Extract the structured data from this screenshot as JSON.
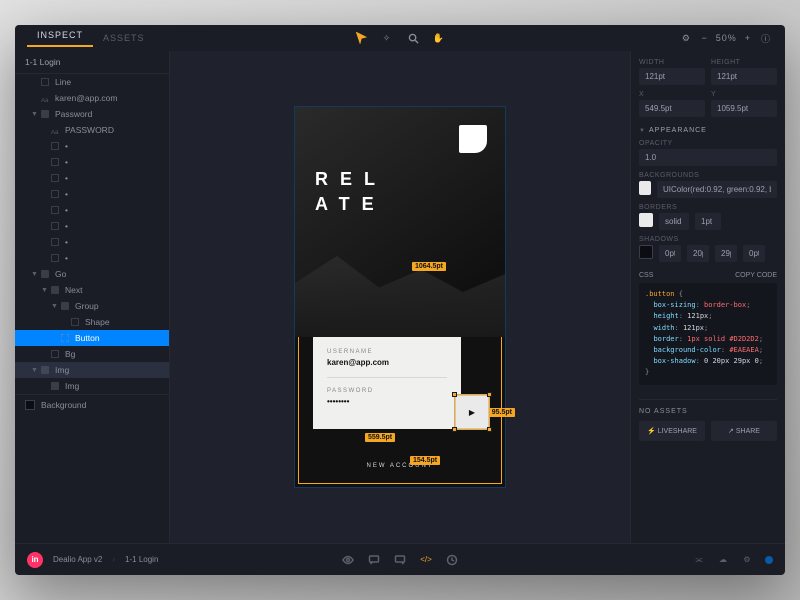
{
  "tabs": {
    "inspect": "INSPECT",
    "assets": "ASSETS"
  },
  "zoom": "50%",
  "artboard_title": "1-1 Login",
  "layers": [
    {
      "name": "Line",
      "indent": 1,
      "icon": "shape"
    },
    {
      "name": "karen@app.com",
      "indent": 1,
      "icon": "text"
    },
    {
      "name": "Password",
      "indent": 1,
      "icon": "folder",
      "chev": "▼"
    },
    {
      "name": "PASSWORD",
      "indent": 2,
      "icon": "text"
    },
    {
      "name": "•",
      "indent": 2,
      "icon": "shape"
    },
    {
      "name": "•",
      "indent": 2,
      "icon": "shape"
    },
    {
      "name": "•",
      "indent": 2,
      "icon": "shape"
    },
    {
      "name": "•",
      "indent": 2,
      "icon": "shape"
    },
    {
      "name": "•",
      "indent": 2,
      "icon": "shape"
    },
    {
      "name": "•",
      "indent": 2,
      "icon": "shape"
    },
    {
      "name": "•",
      "indent": 2,
      "icon": "shape"
    },
    {
      "name": "•",
      "indent": 2,
      "icon": "shape"
    },
    {
      "name": "Go",
      "indent": 1,
      "icon": "folder",
      "chev": "▼"
    },
    {
      "name": "Next",
      "indent": 2,
      "icon": "folder",
      "chev": "▼"
    },
    {
      "name": "Group",
      "indent": 3,
      "icon": "folder",
      "chev": "▼"
    },
    {
      "name": "Shape",
      "indent": 4,
      "icon": "shape"
    },
    {
      "name": "Button",
      "indent": 3,
      "icon": "button",
      "selected": true
    },
    {
      "name": "Bg",
      "indent": 2,
      "icon": "shape"
    },
    {
      "name": "Img",
      "indent": 1,
      "icon": "folder",
      "chev": "▼",
      "highlighted": true
    },
    {
      "name": "Img",
      "indent": 2,
      "icon": "img"
    }
  ],
  "background_label": "Background",
  "canvas": {
    "brand_line1": "REL",
    "brand_line2": "ATE",
    "username_label": "USERNAME",
    "username_value": "karen@app.com",
    "password_label": "PASSWORD",
    "password_value": "••••••••",
    "new_account": "NEW ACCOUNT",
    "m_top": "1064.5pt",
    "m_bottom_left": "559.5pt",
    "m_right": "95.5pt",
    "m_bottom": "154.5pt"
  },
  "inspector": {
    "width_label": "WIDTH",
    "width": "121pt",
    "height_label": "HEIGHT",
    "height": "121pt",
    "x_label": "X",
    "x": "549.5pt",
    "y_label": "Y",
    "y": "1059.5pt",
    "appearance": "APPEARANCE",
    "opacity_label": "OPACITY",
    "opacity": "1.0",
    "backgrounds_label": "BACKGROUNDS",
    "backgrounds_value": "UIColor(red:0.92, green:0.92, b",
    "borders_label": "BORDERS",
    "borders_type": "solid",
    "borders_px": "1pt",
    "shadows_label": "SHADOWS",
    "shadow_x": "0pt",
    "shadow_y": "20pt",
    "shadow_blur": "29pt",
    "shadow_spread": "0pt",
    "css_label": "CSS",
    "copy_label": "COPY CODE",
    "code": {
      "selector": ".button",
      "p1": "box-sizing",
      "v1": "border-box",
      "p2": "height",
      "v2": "121px",
      "p3": "width",
      "v3": "121px",
      "p4": "border",
      "v4": "1px solid #D2D2D2",
      "p5": "background-color",
      "v5": "#EAEAEA",
      "p6": "box-shadow",
      "v6": "0 20px 29px 0"
    },
    "no_assets": "NO ASSETS",
    "liveshare": "LIVESHARE",
    "share": "SHARE"
  },
  "footer": {
    "project": "Dealio App v2",
    "screen": "1-1 Login"
  }
}
